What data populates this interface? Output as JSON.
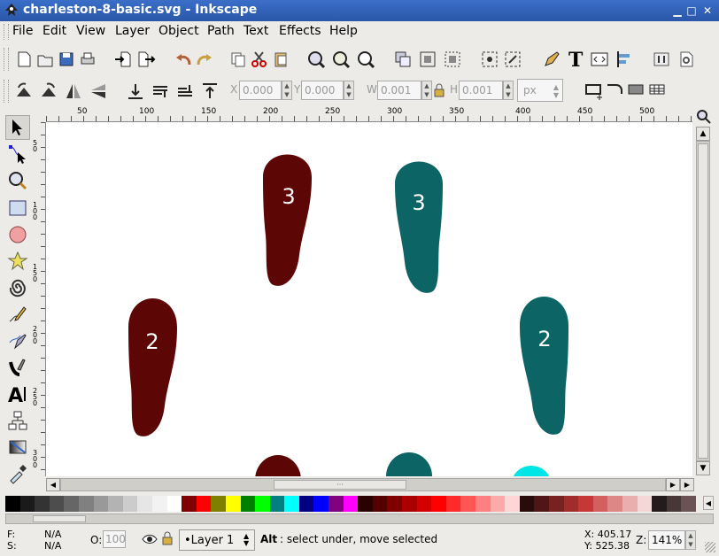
{
  "window": {
    "title": "charleston-8-basic.svg - Inkscape"
  },
  "menu": [
    "File",
    "Edit",
    "View",
    "Layer",
    "Object",
    "Path",
    "Text",
    "Effects",
    "Help"
  ],
  "toolbar2": {
    "x_label": "X",
    "x_value": "0.000",
    "y_label": "Y",
    "y_value": "0.000",
    "w_label": "W",
    "w_value": "0.001",
    "h_label": "H",
    "h_value": "0.001",
    "unit": "px"
  },
  "ruler": {
    "h_ticks": [
      "50",
      "100",
      "150",
      "200",
      "250",
      "300",
      "350",
      "400",
      "450",
      "500"
    ],
    "v_ticks": [
      "50",
      "100",
      "150",
      "200",
      "250",
      "300"
    ]
  },
  "canvas": {
    "footprints": [
      {
        "label": "3",
        "color": "#5c0606"
      },
      {
        "label": "3",
        "color": "#0c6464"
      },
      {
        "label": "2",
        "color": "#5c0606"
      },
      {
        "label": "2",
        "color": "#0c6464"
      }
    ],
    "partial_colors": [
      "#5c0606",
      "#0c6464",
      "#00e5e5"
    ]
  },
  "palette": [
    "#000000",
    "#1a1a1a",
    "#333333",
    "#4d4d4d",
    "#666666",
    "#808080",
    "#999999",
    "#b3b3b3",
    "#cccccc",
    "#e6e6e6",
    "#f2f2f2",
    "#ffffff",
    "#800000",
    "#ff0000",
    "#808000",
    "#ffff00",
    "#008000",
    "#00ff00",
    "#008080",
    "#00ffff",
    "#000080",
    "#0000ff",
    "#800080",
    "#ff00ff",
    "#2b0000",
    "#550000",
    "#800000",
    "#aa0000",
    "#d40000",
    "#ff0000",
    "#ff2a2a",
    "#ff5555",
    "#ff8080",
    "#ffaaaa",
    "#ffd5d5",
    "#280b0b",
    "#501616",
    "#782121",
    "#a02c2c",
    "#c83737",
    "#d35f5f",
    "#de8787",
    "#e9afaf",
    "#f4d7d7",
    "#241c1c",
    "#483737",
    "#6c5353"
  ],
  "status": {
    "fill_label": "F:",
    "fill_value": "N/A",
    "stroke_label": "S:",
    "stroke_value": "N/A",
    "opacity_label": "O:",
    "opacity_value": "100",
    "layer": "•Layer 1",
    "message_key": "Alt",
    "message": ": select under, move selected",
    "x_coord": "X: 405.17",
    "y_coord": "Y: 525.38",
    "zoom_label": "Z:",
    "zoom": "141%"
  }
}
